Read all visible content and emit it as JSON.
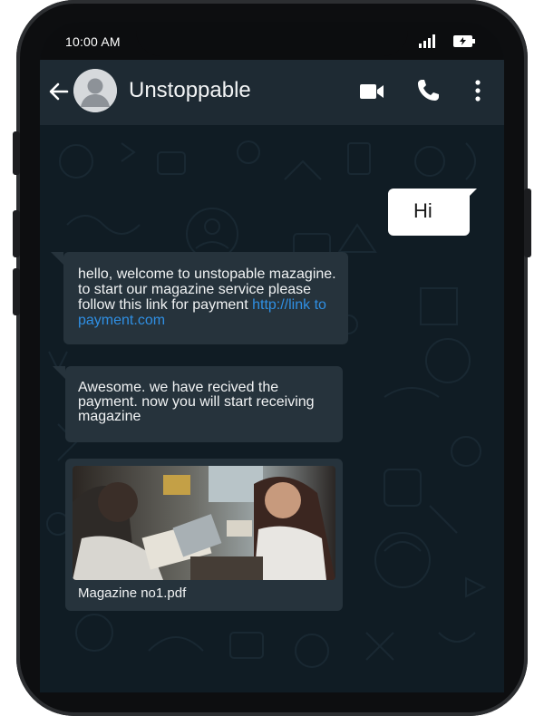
{
  "status_bar": {
    "time": "10:00 AM"
  },
  "header": {
    "contact_name": "Unstoppable"
  },
  "messages": {
    "outgoing_1": "Hi",
    "incoming_1": {
      "text": "hello, welcome to unstopable mazagine. to start our magazine service please follow this link for payment",
      "link": "http://link to payment.com"
    },
    "incoming_2": "Awesome. we have recived the payment. now you will start receiving magazine",
    "attachment": {
      "filename": "Magazine no1.pdf"
    }
  },
  "icons": {
    "back": "arrow-back-icon",
    "avatar": "user-avatar-icon",
    "video": "video-camera-icon",
    "call": "phone-icon",
    "menu": "more-vertical-icon",
    "signal": "signal-icon",
    "battery": "battery-icon"
  },
  "colors": {
    "header": "#1e2a33",
    "chat_background": "#101c24",
    "incoming_bubble": "#26333c",
    "outgoing_bubble": "#ffffff",
    "link": "#2f8fe3"
  }
}
